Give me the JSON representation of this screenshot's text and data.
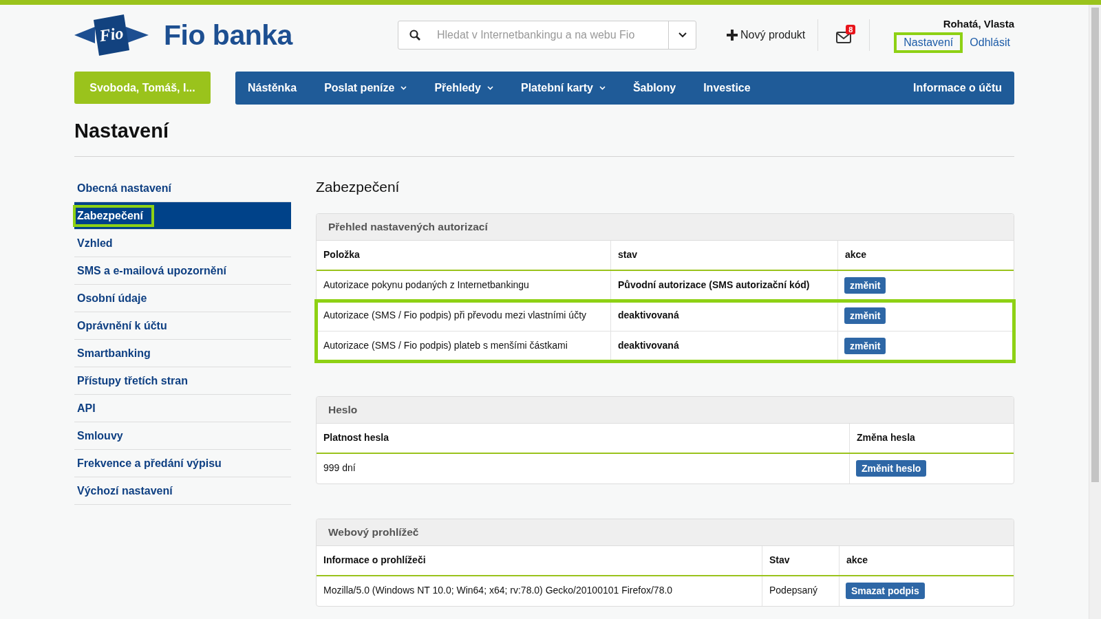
{
  "logo": {
    "emblem_text": "Fio",
    "brand": "Fio banka"
  },
  "search": {
    "placeholder": "Hledat v Internetbankingu a na webu Fio"
  },
  "new_product": "Nový produkt",
  "messages": {
    "badge": "8"
  },
  "user": {
    "name": "Rohatá, Vlasta",
    "links": [
      {
        "label": "Nastavení",
        "highlighted": true
      },
      {
        "label": "Odhlásit",
        "highlighted": false
      }
    ]
  },
  "account_button": "Svoboda, Tomáš, I...",
  "nav": [
    {
      "label": "Nástěnka",
      "dropdown": false
    },
    {
      "label": "Poslat peníze",
      "dropdown": true
    },
    {
      "label": "Přehledy",
      "dropdown": true
    },
    {
      "label": "Platební karty",
      "dropdown": true
    },
    {
      "label": "Šablony",
      "dropdown": false
    },
    {
      "label": "Investice",
      "dropdown": false
    }
  ],
  "nav_right": "Informace o účtu",
  "page_title": "Nastavení",
  "sidebar": [
    {
      "label": "Obecná nastavení",
      "selected": false,
      "highlighted": false
    },
    {
      "label": "Zabezpečení",
      "selected": true,
      "highlighted": true
    },
    {
      "label": "Vzhled",
      "selected": false,
      "highlighted": false
    },
    {
      "label": "SMS a e-mailová upozornění",
      "selected": false,
      "highlighted": false
    },
    {
      "label": "Osobní údaje",
      "selected": false,
      "highlighted": false
    },
    {
      "label": "Oprávnění k účtu",
      "selected": false,
      "highlighted": false
    },
    {
      "label": "Smartbanking",
      "selected": false,
      "highlighted": false
    },
    {
      "label": "Přístupy třetích stran",
      "selected": false,
      "highlighted": false
    },
    {
      "label": "API",
      "selected": false,
      "highlighted": false
    },
    {
      "label": "Smlouvy",
      "selected": false,
      "highlighted": false
    },
    {
      "label": "Frekvence a předání výpisu",
      "selected": false,
      "highlighted": false
    },
    {
      "label": "Výchozí nastavení",
      "selected": false,
      "highlighted": false
    }
  ],
  "section_title": "Zabezpečení",
  "panels": [
    {
      "title": "Přehled nastavených autorizací",
      "columns": [
        "Položka",
        "stav",
        "akce"
      ],
      "rows": [
        {
          "cells": [
            {
              "text": "Autorizace pokynu podaných z Internetbankingu",
              "bold": false
            },
            {
              "text": "Původní autorizace (SMS autorizační kód)",
              "bold": true
            }
          ],
          "action": "změnit",
          "highlighted": false
        },
        {
          "cells": [
            {
              "text": "Autorizace (SMS / Fio podpis) při převodu mezi vlastními účty",
              "bold": false
            },
            {
              "text": "deaktivovaná",
              "bold": true
            }
          ],
          "action": "změnit",
          "highlighted": true
        },
        {
          "cells": [
            {
              "text": "Autorizace (SMS / Fio podpis) plateb s menšími částkami",
              "bold": false
            },
            {
              "text": "deaktivovaná",
              "bold": true
            }
          ],
          "action": "změnit",
          "highlighted": true
        }
      ]
    },
    {
      "title": "Heslo",
      "columns": [
        "Platnost hesla",
        "Změna hesla"
      ],
      "rows": [
        {
          "cells": [
            {
              "text": "999 dní",
              "bold": false
            }
          ],
          "action": "Změnit heslo",
          "highlighted": false
        }
      ]
    },
    {
      "title": "Webový prohlížeč",
      "columns": [
        "Informace o prohlížeči",
        "Stav",
        "akce"
      ],
      "rows": [
        {
          "cells": [
            {
              "text": "Mozilla/5.0 (Windows NT 10.0; Win64; x64; rv:78.0) Gecko/20100101 Firefox/78.0",
              "bold": false
            },
            {
              "text": "Podepsaný",
              "bold": false
            }
          ],
          "action": "Smazat podpis",
          "highlighted": false
        }
      ]
    }
  ]
}
